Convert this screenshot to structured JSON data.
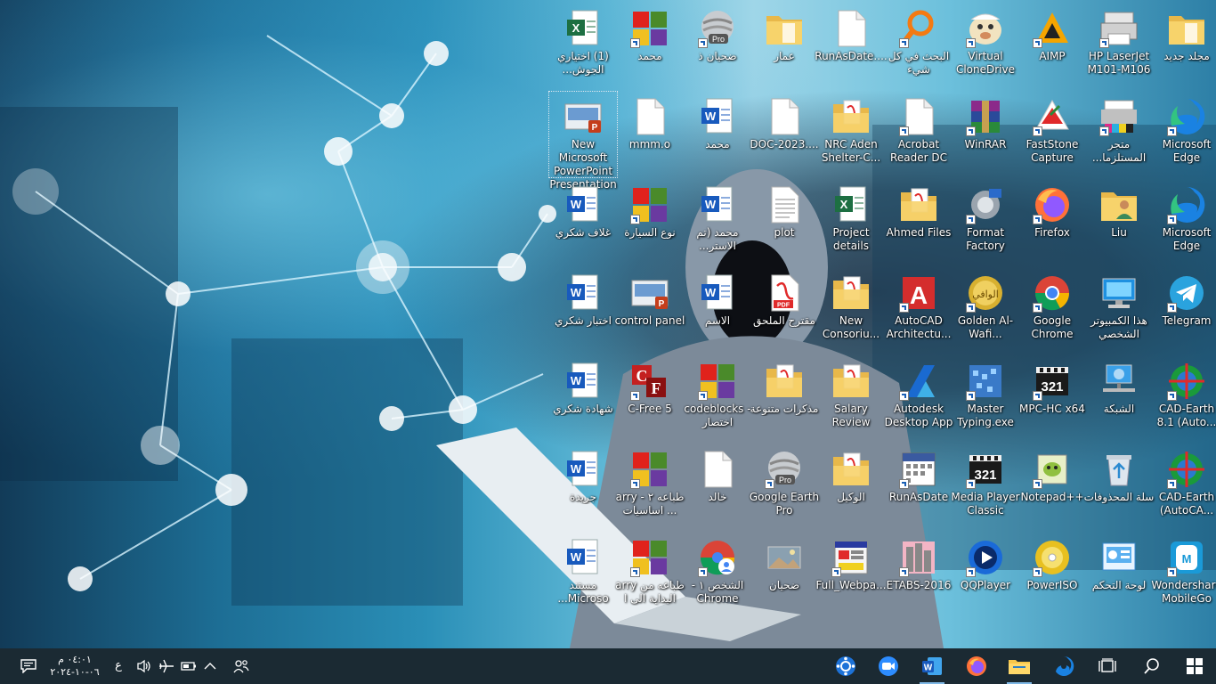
{
  "desktop": {
    "icons": [
      {
        "label": "(1) اختياري الجوش...",
        "icon": "excel-file-icon"
      },
      {
        "label": "محمد",
        "icon": "app-shortcut-icon"
      },
      {
        "label": "ضحيان ذ",
        "icon": "google-earth-pro-icon"
      },
      {
        "label": "عمار",
        "icon": "folder-icon"
      },
      {
        "label": "RunAsDate....",
        "icon": "blank-file-icon"
      },
      {
        "label": "البحث في كل شيء",
        "icon": "everything-search-icon"
      },
      {
        "label": "Virtual CloneDrive",
        "icon": "virtual-clonedrive-icon"
      },
      {
        "label": "AIMP",
        "icon": "aimp-icon"
      },
      {
        "label": "HP LaserJet M101-M106",
        "icon": "printer-icon"
      },
      {
        "label": "مجلد جديد",
        "icon": "folder-icon"
      },
      {
        "label": "New Microsoft PowerPoint Presentation",
        "icon": "powerpoint-file-icon"
      },
      {
        "label": "mmm.o",
        "icon": "blank-file-icon"
      },
      {
        "label": "محمد",
        "icon": "word-file-icon"
      },
      {
        "label": "DOC-2023....",
        "icon": "blank-file-icon"
      },
      {
        "label": "NRC Aden Shelter-C...",
        "icon": "pdf-folder-icon"
      },
      {
        "label": "Acrobat Reader DC",
        "icon": "blank-file-icon"
      },
      {
        "label": "WinRAR",
        "icon": "winrar-icon"
      },
      {
        "label": "FastStone Capture",
        "icon": "faststone-capture-icon"
      },
      {
        "label": "متجر المستلزما...",
        "icon": "printer-store-icon"
      },
      {
        "label": "Microsoft Edge",
        "icon": "edge-icon"
      },
      {
        "label": "غلاف شكري",
        "icon": "word-file-icon"
      },
      {
        "label": "نوع السيارة",
        "icon": "app-shortcut-icon"
      },
      {
        "label": "محمد (تم الاستر...",
        "icon": "word-file-icon"
      },
      {
        "label": "plot",
        "icon": "text-file-icon"
      },
      {
        "label": "Project details",
        "icon": "excel-file-icon"
      },
      {
        "label": "Ahmed Files",
        "icon": "pdf-folder-icon"
      },
      {
        "label": "Format Factory",
        "icon": "format-factory-icon"
      },
      {
        "label": "Firefox",
        "icon": "firefox-icon"
      },
      {
        "label": "Liu",
        "icon": "user-folder-icon"
      },
      {
        "label": "Microsoft Edge",
        "icon": "edge-icon"
      },
      {
        "label": "اختبار شكري",
        "icon": "word-file-icon"
      },
      {
        "label": "control panel",
        "icon": "powerpoint-file-icon"
      },
      {
        "label": "الاسم",
        "icon": "word-file-icon"
      },
      {
        "label": "مقترح الملحق",
        "icon": "pdf-file-icon"
      },
      {
        "label": "New Consoriu...",
        "icon": "pdf-folder-icon"
      },
      {
        "label": "AutoCAD Architectu...",
        "icon": "autocad-icon"
      },
      {
        "label": "Golden Al-Wafi...",
        "icon": "golden-alwafi-icon"
      },
      {
        "label": "Google Chrome",
        "icon": "chrome-icon"
      },
      {
        "label": "هذا الكمبيوتر الشخصي",
        "icon": "this-pc-icon"
      },
      {
        "label": "Telegram",
        "icon": "telegram-icon"
      },
      {
        "label": "شهادة شكري",
        "icon": "word-file-icon"
      },
      {
        "label": "C-Free 5",
        "icon": "cfree-icon"
      },
      {
        "label": "codeblocks - اختصار",
        "icon": "app-shortcut-icon"
      },
      {
        "label": "مذكرات متنوعة",
        "icon": "pdf-folder-icon"
      },
      {
        "label": "Salary Review",
        "icon": "pdf-folder-icon"
      },
      {
        "label": "Autodesk Desktop App",
        "icon": "autodesk-icon"
      },
      {
        "label": "Master Typing.exe",
        "icon": "master-typing-icon"
      },
      {
        "label": "MPC-HC x64",
        "icon": "mpc-icon"
      },
      {
        "label": "الشبكة",
        "icon": "network-icon"
      },
      {
        "label": "CAD-Earth 8.1 (Auto...",
        "icon": "cad-earth-icon"
      },
      {
        "label": "جريدة",
        "icon": "word-file-icon"
      },
      {
        "label": "arry طباعه ٢ - اساسيات ...",
        "icon": "app-shortcut-icon"
      },
      {
        "label": "خالد",
        "icon": "blank-file-icon"
      },
      {
        "label": "Google Earth Pro",
        "icon": "google-earth-pro-icon"
      },
      {
        "label": "الوكيل",
        "icon": "pdf-folder-icon"
      },
      {
        "label": "RunAsDate",
        "icon": "runasdate-icon"
      },
      {
        "label": "Media Player Classic",
        "icon": "mpc-icon"
      },
      {
        "label": "Notepad++",
        "icon": "notepadpp-icon"
      },
      {
        "label": "سلة المحذوفات",
        "icon": "recycle-bin-icon"
      },
      {
        "label": "CAD-Earth (AutoCA...",
        "icon": "cad-earth-icon"
      },
      {
        "label": "مستند Microso...",
        "icon": "word-file-icon"
      },
      {
        "label": "arry طباعه من البداية الى ا",
        "icon": "app-shortcut-icon"
      },
      {
        "label": "الشخص ١ - Chrome",
        "icon": "chrome-profile-icon"
      },
      {
        "label": "ضحيان",
        "icon": "image-file-icon"
      },
      {
        "label": "Full_Webpa...",
        "icon": "webpage-icon"
      },
      {
        "label": "ETABS-2016",
        "icon": "etabs-icon"
      },
      {
        "label": "QQPlayer",
        "icon": "qqplayer-icon"
      },
      {
        "label": "PowerISO",
        "icon": "poweriso-icon"
      },
      {
        "label": "لوحة التحكم",
        "icon": "control-panel-icon"
      },
      {
        "label": "Wondershare MobileGo",
        "icon": "mobilego-icon"
      }
    ]
  },
  "taskbar": {
    "notification_icon": "action-center-icon",
    "time": "٠٤:٠١ م",
    "date": "٠٦-١٠-٢٠٢٤",
    "input_lang": "ع",
    "tray_icons": [
      "volume-icon",
      "airplane-icon",
      "battery-icon",
      "chevron-up-icon",
      "people-icon"
    ],
    "pinned": [
      "settings-icon",
      "zoom-icon",
      "word-icon",
      "firefox-icon",
      "file-explorer-icon",
      "edge-icon"
    ],
    "task_view": "task-view-icon",
    "search": "search-icon",
    "start": "windows-start-icon"
  }
}
